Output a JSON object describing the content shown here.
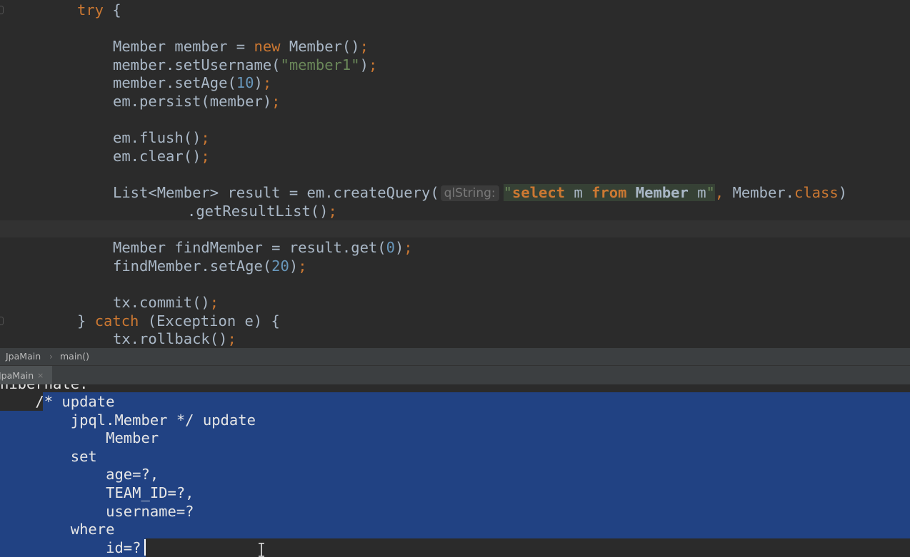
{
  "editor": {
    "lines": {
      "try": "try",
      "try_brace": " {",
      "l1_a": "Member member = ",
      "l1_new": "new",
      "l1_b": " Member()",
      "l2_a": "member.setUsername(",
      "l2_str": "\"member1\"",
      "l2_b": ")",
      "l3_a": "member.setAge(",
      "l3_num": "10",
      "l3_b": ")",
      "l4": "em.persist(member)",
      "l5": "em.flush()",
      "l6": "em.clear()",
      "l7_a": "List<Member> result = em.createQuery(",
      "l7_hint": "qlString:",
      "l7_q_open": "\"",
      "l7_select": "select",
      "l7_m1": " m ",
      "l7_from": "from",
      "l7_sp": " ",
      "l7_member": "Member",
      "l7_m2": " m",
      "l7_q_close": "\"",
      "l7_comma": ",",
      "l7_b": " Member.",
      "l7_class": "class",
      "l7_c": ")",
      "l8": ".getResultList()",
      "l9_a": "Member findMember = result.get(",
      "l9_num": "0",
      "l9_b": ")",
      "l10_a": "findMember.setAge(",
      "l10_num": "20",
      "l10_b": ")",
      "l11": "tx.commit()",
      "l12_a": "} ",
      "l12_catch": "catch",
      "l12_b": " (Exception e) {",
      "l13": "tx.rollback()",
      "semicolon": ";"
    }
  },
  "breadcrumb": {
    "class_name": "JpaMain",
    "separator": "›",
    "method_name": "main()"
  },
  "run_panel": {
    "tab_label": "JpaMain",
    "close_symbol": "×"
  },
  "console": {
    "cut_line": "hibernate:",
    "lines": [
      "    /* update",
      "        jpql.Member */ update",
      "            Member",
      "        set",
      "            age=?,",
      "            TEAM_ID=?,",
      "            username=?",
      "        where",
      "            id=?"
    ]
  },
  "colors": {
    "editor_bg": "#2b2b2b",
    "keyword": "#cc7832",
    "string": "#6a8759",
    "number": "#6897bb",
    "selection": "#214283"
  }
}
